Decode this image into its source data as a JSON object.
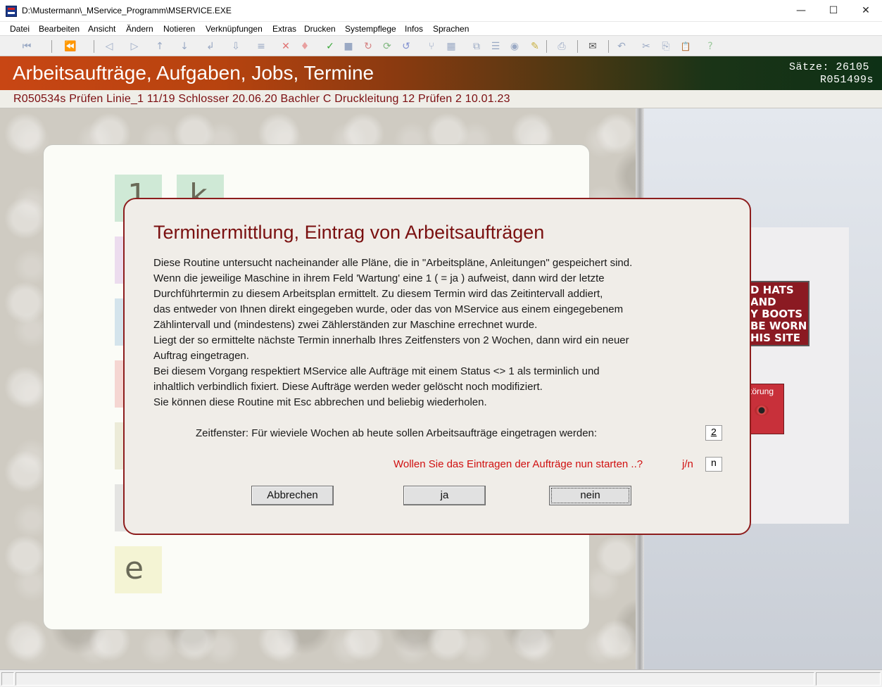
{
  "window": {
    "title": "D:\\Mustermann\\_MService_Programm\\MSERVICE.EXE",
    "min_glyph": "—",
    "max_glyph": "☐",
    "close_glyph": "✕"
  },
  "menu": {
    "items": [
      "Datei",
      "Bearbeiten",
      "Ansicht",
      "Ändern",
      "Notieren",
      "Verknüpfungen",
      "Extras",
      "Drucken",
      "Systempflege",
      "Infos",
      "Sprachen"
    ]
  },
  "toolbar": {
    "icons": [
      {
        "name": "first-record-icon",
        "glyph": "⏮"
      },
      {
        "name": "page-back-icon",
        "glyph": "⏪"
      },
      {
        "name": "prev-record-icon",
        "glyph": "◁"
      },
      {
        "name": "next-record-icon",
        "glyph": "▷"
      },
      {
        "name": "up-arrow-icon",
        "glyph": "↑"
      },
      {
        "name": "down-arrow-icon",
        "glyph": "↓"
      },
      {
        "name": "enter-icon",
        "glyph": "↲"
      },
      {
        "name": "import-icon",
        "glyph": "⇩"
      },
      {
        "name": "list-icon",
        "glyph": "≡"
      },
      {
        "name": "delete-icon",
        "glyph": "✕"
      },
      {
        "name": "undo-delete-icon",
        "glyph": "♦"
      },
      {
        "name": "confirm-icon",
        "glyph": "✓"
      },
      {
        "name": "save-icon",
        "glyph": "■"
      },
      {
        "name": "rotate-icon",
        "glyph": "↻"
      },
      {
        "name": "refresh-icon",
        "glyph": "⟳"
      },
      {
        "name": "sync-icon",
        "glyph": "↺"
      },
      {
        "name": "split-icon",
        "glyph": "⑂"
      },
      {
        "name": "table-icon",
        "glyph": "▦"
      },
      {
        "name": "copy-record-icon",
        "glyph": "⧉"
      },
      {
        "name": "align-icon",
        "glyph": "☰"
      },
      {
        "name": "view-icon",
        "glyph": "◉"
      },
      {
        "name": "highlight-icon",
        "glyph": "✎"
      },
      {
        "name": "printer-icon",
        "glyph": "⎙"
      },
      {
        "name": "mail-icon",
        "glyph": "✉"
      },
      {
        "name": "undo-icon",
        "glyph": "↶"
      },
      {
        "name": "cut-icon",
        "glyph": "✂"
      },
      {
        "name": "copy-icon",
        "glyph": "⎘"
      },
      {
        "name": "paste-icon",
        "glyph": "📋"
      },
      {
        "name": "help-icon",
        "glyph": "?"
      }
    ]
  },
  "header": {
    "title": "Arbeitsaufträge, Aufgaben, Jobs, Termine",
    "saetze": "Sätze:  26105",
    "record_no": "R051499s"
  },
  "info_line": "R050534s  Prüfen  Linie_1  11/19  Schlosser  20.06.20 Bachler  C  Druckleitung 12 Prüfen  2  10.01.23",
  "tiles": [
    {
      "letter": "1",
      "color": "#cfe9d6"
    },
    {
      "letter": "k",
      "color": "#cfe9d6"
    },
    {
      "letter": "",
      "color": "#ecdcee"
    },
    {
      "letter": "",
      "color": "#d4e4ec"
    },
    {
      "letter": "",
      "color": "#f5d6d2"
    },
    {
      "letter": "",
      "color": "#ecebd8"
    },
    {
      "letter": "",
      "color": "#e4e4e2"
    },
    {
      "letter": "e",
      "color": "#f4f4d4"
    }
  ],
  "side_sign": {
    "text": "D HATS\nAND\nY BOOTS\nBE WORN\nHIS SITE",
    "alarm_label": "törung"
  },
  "dialog": {
    "title": "Terminermittlung, Eintrag von Arbeitsaufträgen",
    "lines": [
      "Diese Routine untersucht nacheinander alle Pläne, die in \"Arbeitspläne, Anleitungen\" gespeichert sind.",
      "Wenn die jeweilige Maschine in ihrem Feld 'Wartung' eine 1  ( = ja ) aufweist, dann wird der letzte",
      "Durchführtermin zu diesem Arbeitsplan ermittelt.  Zu diesem Termin wird das Zeitintervall addiert,",
      "das entweder von Ihnen direkt eingegeben wurde,  oder das von MService aus einem eingegebenem",
      "Zählintervall und  (mindestens)  zwei Zählerständen zur Maschine  errechnet wurde.",
      "Liegt der so ermittelte nächste Termin innerhalb Ihres Zeitfensters von 2 Wochen, dann wird ein neuer",
      "Auftrag eingetragen.",
      "Bei diesem Vorgang respektiert MService alle Aufträge mit einem Status <> 1 als terminlich und",
      "inhaltlich verbindlich fixiert. Diese Aufträge werden weder gelöscht noch modifiziert.",
      "Sie können diese Routine mit Esc abbrechen und beliebig wiederholen."
    ],
    "zeitfenster_label": "Zeitfenster:  Für wieviele Wochen ab heute sollen Arbeitsaufträge eingetragen werden:",
    "zeitfenster_value": "2",
    "start_question": "Wollen Sie das Eintragen der Aufträge nun starten ..?",
    "jn_label": "j/n",
    "start_value": "n",
    "buttons": {
      "abbrechen": "Abbrechen",
      "ja": "ja",
      "nein": "nein"
    }
  }
}
